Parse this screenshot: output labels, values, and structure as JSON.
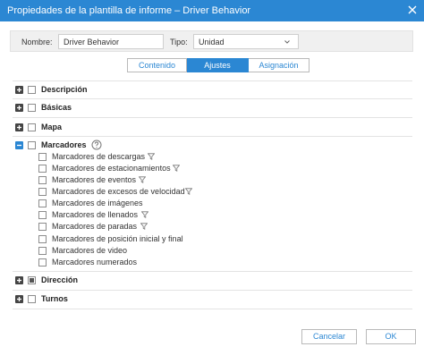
{
  "dialog": {
    "title": "Propiedades de la plantilla de informe – Driver Behavior",
    "close_icon": "close-icon"
  },
  "form": {
    "name_label": "Nombre:",
    "name_value": "Driver Behavior",
    "type_label": "Tipo:",
    "type_value": "Unidad"
  },
  "tabs": [
    {
      "label": "Contenido",
      "active": false
    },
    {
      "label": "Ajustes",
      "active": true
    },
    {
      "label": "Asignación",
      "active": false
    }
  ],
  "sections": {
    "descripcion": "Descripción",
    "basicas": "Básicas",
    "mapa": "Mapa",
    "marcadores": "Marcadores",
    "direccion": "Dirección",
    "turnos": "Turnos"
  },
  "marcadores_items": [
    {
      "label": "Marcadores de descargas",
      "filter": true
    },
    {
      "label": "Marcadores de estacionamientos",
      "filter": true
    },
    {
      "label": "Marcadores de eventos",
      "filter": true
    },
    {
      "label": "Marcadores de excesos de velocidad",
      "filter": true
    },
    {
      "label": "Marcadores de imágenes",
      "filter": false
    },
    {
      "label": "Marcadores de llenados",
      "filter": true
    },
    {
      "label": "Marcadores de paradas",
      "filter": true
    },
    {
      "label": "Marcadores de posición inicial y final",
      "filter": false
    },
    {
      "label": "Marcadores de video",
      "filter": false
    },
    {
      "label": "Marcadores numerados",
      "filter": false
    }
  ],
  "buttons": {
    "cancel": "Cancelar",
    "ok": "OK"
  },
  "colors": {
    "accent": "#2b87d3",
    "titlebar": "#2b87d3"
  }
}
